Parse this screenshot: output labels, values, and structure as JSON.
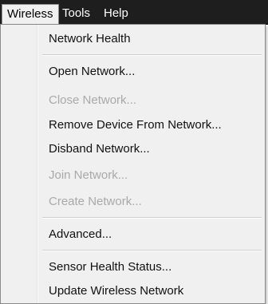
{
  "menubar": {
    "items": [
      {
        "label": "Wireless"
      },
      {
        "label": "Tools"
      },
      {
        "label": "Help"
      }
    ]
  },
  "dropdown": {
    "items": [
      {
        "label": "Network Health",
        "enabled": true
      },
      {
        "label": "Open Network...",
        "enabled": true
      },
      {
        "label": "Close Network...",
        "enabled": false
      },
      {
        "label": "Remove Device From Network...",
        "enabled": true
      },
      {
        "label": "Disband Network...",
        "enabled": true
      },
      {
        "label": "Join Network...",
        "enabled": false
      },
      {
        "label": "Create Network...",
        "enabled": false
      },
      {
        "label": "Advanced...",
        "enabled": true
      },
      {
        "label": "Sensor Health Status...",
        "enabled": true
      },
      {
        "label": "Update Wireless Network",
        "enabled": true
      }
    ]
  }
}
